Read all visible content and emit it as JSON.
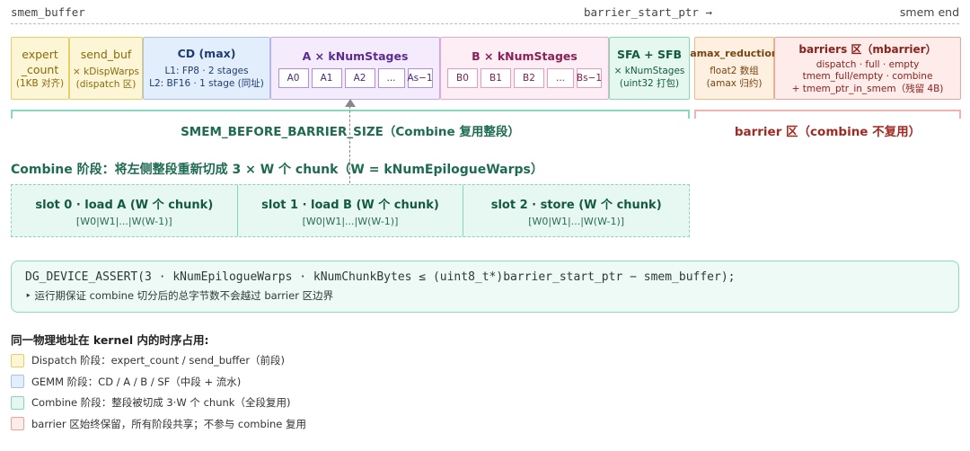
{
  "header": {
    "left": "smem_buffer",
    "mid": "barrier_start_ptr →",
    "right": "smem end"
  },
  "segments": {
    "expert": {
      "title_line1": "expert",
      "title_line2": "_count",
      "sub": "(1KB 对齐)"
    },
    "send_buf": {
      "title": "send_buf",
      "sub1": "× kDispWarps",
      "sub2": "(dispatch 区)"
    },
    "cd": {
      "title": "CD (max)",
      "sub1": "L1: FP8 · 2 stages",
      "sub2": "L2: BF16 · 1 stage (同址)"
    },
    "a": {
      "title": "A × kNumStages",
      "stages": [
        "A0",
        "A1",
        "A2",
        "...",
        "As−1"
      ]
    },
    "b": {
      "title": "B × kNumStages",
      "stages": [
        "B0",
        "B1",
        "B2",
        "...",
        "Bs−1"
      ]
    },
    "sf": {
      "title": "SFA + SFB",
      "sub1": "× kNumStages",
      "sub2": "(uint32 打包)"
    },
    "amax": {
      "title": "amax_reduction",
      "sub1": "float2 数组",
      "sub2": "(amax 归约)"
    },
    "barriers": {
      "title": "barriers 区（mbarrier）",
      "sub1": "dispatch · full · empty",
      "sub2": "tmem_full/empty · combine",
      "sub3": "+ tmem_ptr_in_smem（残留 4B)"
    }
  },
  "brackets": {
    "green_label": "SMEM_BEFORE_BARRIER_SIZE（Combine 复用整段）",
    "red_label": "barrier 区（combine 不复用）"
  },
  "combine": {
    "title": "Combine 阶段：将左侧整段重新切成 3 × W 个 chunk（W = kNumEpilogueWarps）",
    "slots": [
      {
        "title": "slot 0 · load A (W 个 chunk)",
        "sub": "[W0|W1|...|W(W-1)]"
      },
      {
        "title": "slot 1 · load B (W 个 chunk)",
        "sub": "[W0|W1|...|W(W-1)]"
      },
      {
        "title": "slot 2 · store (W 个 chunk)",
        "sub": "[W0|W1|...|W(W-1)]"
      }
    ]
  },
  "assert": {
    "code": "DG_DEVICE_ASSERT(3 · kNumEpilogueWarps · kNumChunkBytes ≤ (uint8_t*)barrier_start_ptr − smem_buffer);",
    "note": "‣ 运行期保证 combine 切分后的总字节数不会越过 barrier 区边界"
  },
  "legend": {
    "title": "同一物理地址在 kernel 内的时序占用:",
    "items": [
      {
        "text": "Dispatch 阶段：expert_count / send_buffer（前段)",
        "color": "#fdf6d6",
        "border": "#e6cf69"
      },
      {
        "text": "GEMM 阶段：CD / A / B / SF（中段 + 流水)",
        "color": "#e3eefc",
        "border": "#a7c3ea"
      },
      {
        "text": "Combine 阶段：整段被切成 3·W 个 chunk（全段复用)",
        "color": "#e4f8f0",
        "border": "#88d6b6"
      },
      {
        "text": "barrier 区始终保留，所有阶段共享；不参与 combine 复用",
        "color": "#fdecea",
        "border": "#eaa49c"
      }
    ]
  }
}
